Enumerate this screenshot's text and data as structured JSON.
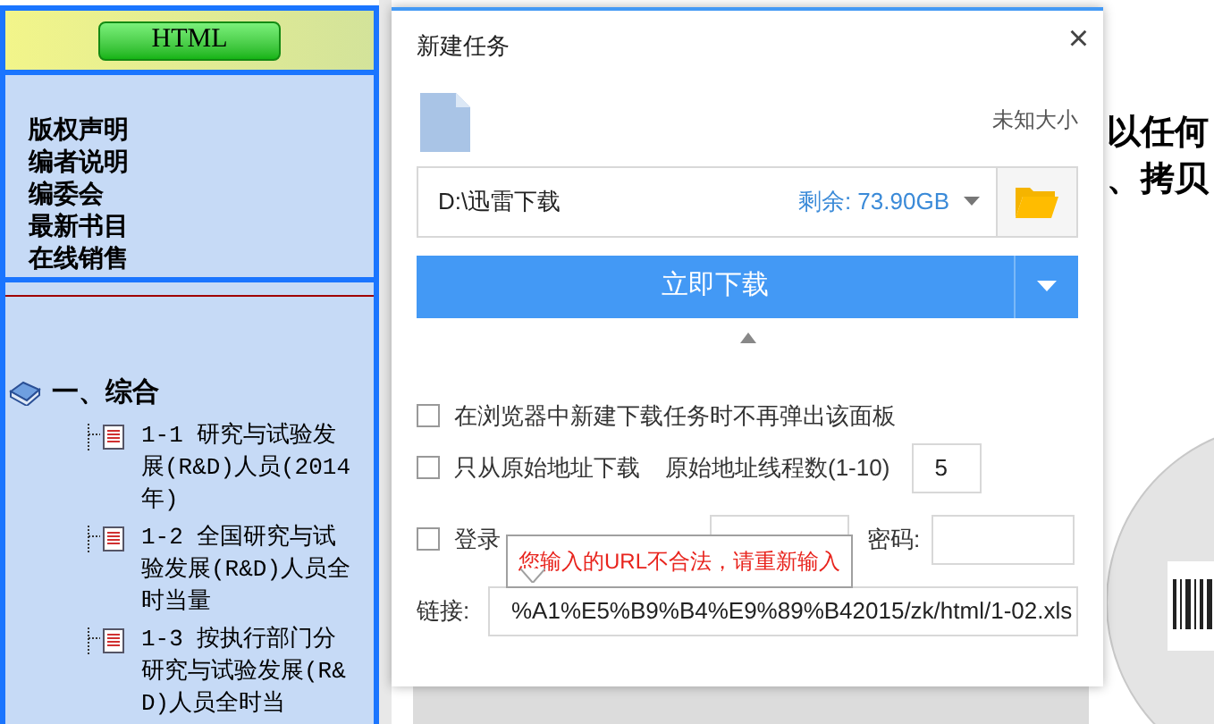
{
  "left_frame": {
    "header_button": "HTML",
    "links": [
      "版权声明",
      "编者说明",
      "编委会",
      "最新书目",
      "在线销售"
    ],
    "tree": [
      {
        "label": "一、综合",
        "children": [
          {
            "label": "1-1 研究与试验发展(R&D)人员(2014年)"
          },
          {
            "label": "1-2 全国研究与试验发展(R&D)人员全时当量"
          },
          {
            "label": "1-3 按执行部门分研究与试验发展(R&D)人员全时当"
          }
        ]
      }
    ]
  },
  "background_page": {
    "text_lines": [
      "以任何",
      "、拷贝"
    ]
  },
  "dialog": {
    "title": "新建任务",
    "close": "×",
    "file_size": "未知大小",
    "save_path": {
      "value": "D:\\迅雷下载",
      "free_space": "剩余: 73.90GB"
    },
    "download_button": "立即下载",
    "options": [
      {
        "kind": "checkbox",
        "label": "在浏览器中新建下载任务时不再弹出该面板",
        "checked": false
      },
      {
        "kind": "threads",
        "label": "只从原始地址下载",
        "checked": false,
        "threads_label": "原始地址线程数(1-10)",
        "threads_value": "5"
      },
      {
        "kind": "login",
        "label": "登录",
        "checked": false,
        "password_label": "密码:"
      }
    ],
    "tooltip": "您输入的URL不合法，请重新输入",
    "link": {
      "label": "链接:",
      "value": "%A1%E5%B9%B4%E9%89%B42015/zk/html/1-02.xls"
    }
  }
}
